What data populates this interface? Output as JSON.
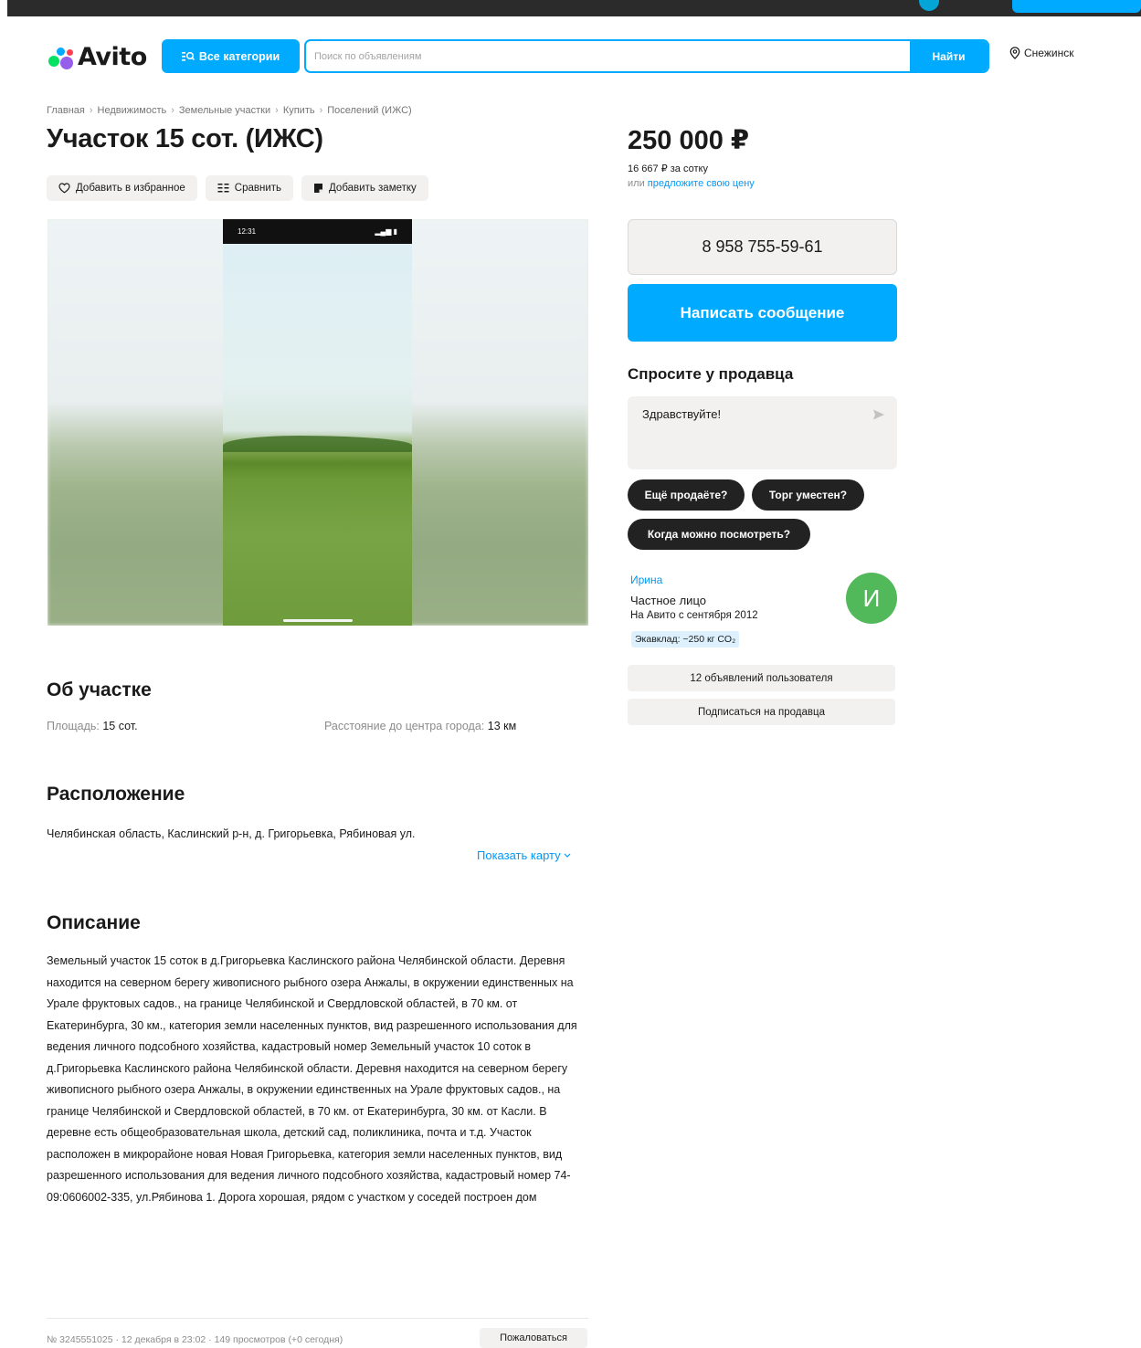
{
  "header": {
    "logo_text": "Avito",
    "categories_label": "Все категории",
    "search_placeholder": "Поиск по объявлениям",
    "search_value": "",
    "search_button": "Найти",
    "location": "Снежинск"
  },
  "breadcrumbs": [
    "Главная",
    "Недвижимость",
    "Земельные участки",
    "Купить",
    "Поселений (ИЖС)"
  ],
  "breadcrumb_separator": "›",
  "listing": {
    "title": "Участок 15 сот. (ИЖС)",
    "actions": {
      "favorite": "Добавить в избранное",
      "compare": "Сравнить",
      "note": "Добавить заметку"
    },
    "photo": {
      "status_time": "12:31",
      "status_icons": "▂▄▆ ▮"
    }
  },
  "price": {
    "value": "250 000 ₽",
    "per_unit": "16 667 ₽ за сотку",
    "offer_prefix": "или ",
    "offer_link": "предложите свою цену"
  },
  "contact": {
    "phone": "8 958 755-59-61",
    "message_button": "Написать сообщение"
  },
  "ask": {
    "title": "Спросите у продавца",
    "message_value": "Здравствуйте!",
    "chips": [
      "Ещё продаёте?",
      "Торг уместен?",
      "Когда можно посмотреть?"
    ]
  },
  "seller": {
    "name": "Ирина",
    "type": "Частное лицо",
    "since": "На Авито с сентября 2012",
    "eco_badge": "Экавклад: ~250 кг CO₂",
    "avatar_letter": "И",
    "avatar_color": "#52b95a",
    "ads_button": "12 объявлений пользователя",
    "subscribe_button": "Подписаться на продавца"
  },
  "about": {
    "title": "Об участке",
    "params": [
      {
        "key": "Площадь: ",
        "value": "15 сот."
      },
      {
        "key": "Расстояние до центра города: ",
        "value": "13 км"
      }
    ]
  },
  "location_section": {
    "title": "Расположение",
    "address": "Челябинская область, Каслинский р-н, д. Григорьевка, Рябиновая ул.",
    "show_map": "Показать карту"
  },
  "description_section": {
    "title": "Описание",
    "text": "Земельный участок 15 соток в д.Григорьевка Каслинского района Челябинской области. Деревня находится на северном берегу живописного рыбного озера Анжалы, в окружении единственных на Урале фруктовых садов., на границе Челябинской и Свердловской областей, в 70 км. от Екатеринбурга, 30 км., категория земли населенных пунктов, вид разрешенного использования для ведения личного подсобного хозяйства, кадастровый номер Земельный участок 10 соток в д.Григорьевка Каслинского района Челябинской области. Деревня находится на северном берегу живописного рыбного озера Анжалы, в окружении единственных на Урале фруктовых садов., на границе Челябинской и Свердловской областей, в 70 км. от Екатеринбурга, 30 км. от Касли. В деревне есть общеобразовательная школа, детский сад, поликлиника, почта и т.д. Участок расположен в микрорайоне новая Новая Григорьевка, категория земли населенных пунктов, вид разрешенного использования для ведения личного подсобного хозяйства, кадастровый номер 74-09:0606002-335, ул.Рябинова 1. Дорога хорошая, рядом с участком у соседей построен дом"
  },
  "footer": {
    "meta": "№ 3245551025 · 12 декабря в 23:02 · 149 просмотров (+0 сегодня)",
    "report_button": "Пожаловаться"
  },
  "colors": {
    "accent": "#00aaff",
    "link": "#0099f7",
    "chip_bg": "#222222"
  }
}
